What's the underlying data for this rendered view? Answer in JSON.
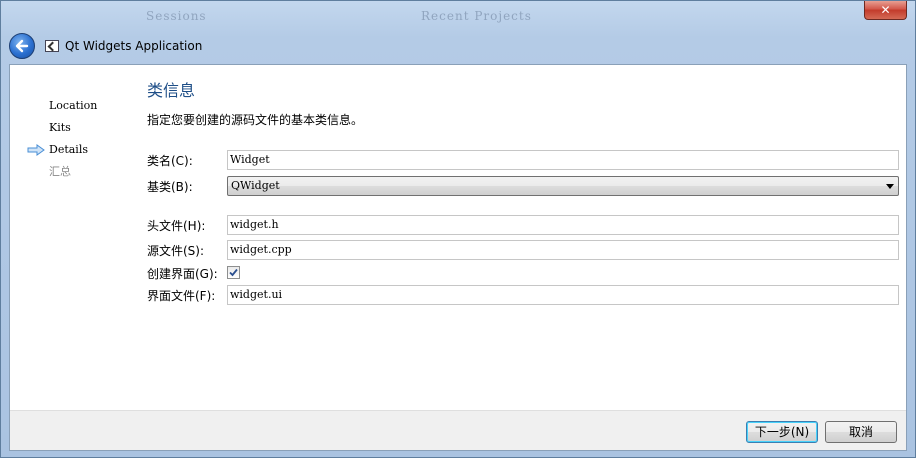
{
  "window": {
    "title": "Qt Widgets Application",
    "close_label": "✕",
    "bg_text_1": "Sessions",
    "bg_text_2": "Recent Projects"
  },
  "steps": [
    {
      "label": "Location",
      "state": "done"
    },
    {
      "label": "Kits",
      "state": "done"
    },
    {
      "label": "Details",
      "state": "current"
    },
    {
      "label": "汇总",
      "state": "future"
    }
  ],
  "page": {
    "title": "类信息",
    "description": "指定您要创建的源码文件的基本类信息。"
  },
  "form": {
    "class_name": {
      "label": "类名(C):",
      "value": "Widget"
    },
    "base_class": {
      "label": "基类(B):",
      "value": "QWidget"
    },
    "header_file": {
      "label": "头文件(H):",
      "value": "widget.h"
    },
    "source_file": {
      "label": "源文件(S):",
      "value": "widget.cpp"
    },
    "generate_form": {
      "label": "创建界面(G):",
      "checked": true
    },
    "form_file": {
      "label": "界面文件(F):",
      "value": "widget.ui"
    }
  },
  "buttons": {
    "next": "下一步(N)",
    "cancel": "取消"
  },
  "colors": {
    "accent_title": "#1e4e87",
    "step_arrow": "#4a8fd6"
  }
}
